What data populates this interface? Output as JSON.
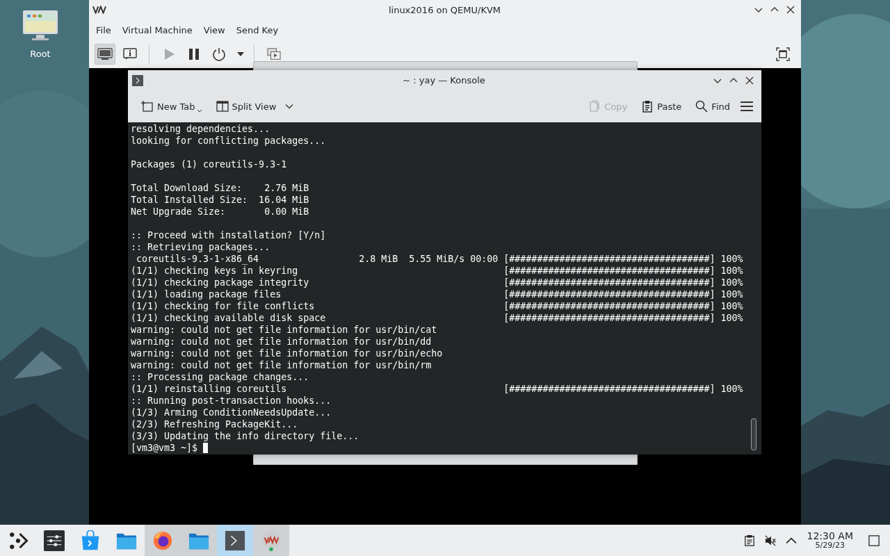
{
  "desktop": {
    "icons": [
      {
        "label": "Root"
      }
    ]
  },
  "vm_window": {
    "title": "linux2016 on QEMU/KVM",
    "menu": [
      "File",
      "Virtual Machine",
      "View",
      "Send Key"
    ],
    "view_buttons": [
      {
        "kind": "console",
        "selected": true
      },
      {
        "kind": "details",
        "selected": false
      }
    ],
    "actions": [
      {
        "kind": "run",
        "disabled": true
      },
      {
        "kind": "pause",
        "disabled": false
      },
      {
        "kind": "power",
        "disabled": false
      },
      {
        "kind": "dropdown",
        "disabled": false
      }
    ]
  },
  "konsole": {
    "title": "~ : yay — Konsole",
    "tools": [
      {
        "kind": "new-tab",
        "label": "New Tab"
      },
      {
        "kind": "split-view",
        "label": "Split View"
      }
    ],
    "actions": [
      {
        "kind": "copy",
        "label": "Copy",
        "disabled": true
      },
      {
        "kind": "paste",
        "label": "Paste",
        "disabled": false
      },
      {
        "kind": "find",
        "label": "Find",
        "disabled": false
      }
    ],
    "lines": [
      {
        "kind": "text",
        "text": "resolving dependencies..."
      },
      {
        "kind": "text",
        "text": "looking for conflicting packages..."
      },
      {
        "kind": "blank"
      },
      {
        "kind": "text",
        "text": "Packages (1) coreutils-9.3-1"
      },
      {
        "kind": "blank"
      },
      {
        "kind": "text",
        "text": "Total Download Size:    2.76 MiB"
      },
      {
        "kind": "text",
        "text": "Total Installed Size:  16.04 MiB"
      },
      {
        "kind": "text",
        "text": "Net Upgrade Size:       0.00 MiB"
      },
      {
        "kind": "blank"
      },
      {
        "kind": "text",
        "text": ":: Proceed with installation? [Y/n]"
      },
      {
        "kind": "text",
        "text": ":: Retrieving packages..."
      },
      {
        "kind": "progress",
        "label": " coreutils-9.3-1-x86_64",
        "size": "2.8 MiB",
        "rate": "5.55 MiB/s",
        "time": "00:00",
        "bar": "[####################################]",
        "percent": "100%"
      },
      {
        "kind": "progress",
        "label": "(1/1) checking keys in keyring",
        "bar": "[####################################]",
        "percent": "100%"
      },
      {
        "kind": "progress",
        "label": "(1/1) checking package integrity",
        "bar": "[####################################]",
        "percent": "100%"
      },
      {
        "kind": "progress",
        "label": "(1/1) loading package files",
        "bar": "[####################################]",
        "percent": "100%"
      },
      {
        "kind": "progress",
        "label": "(1/1) checking for file conflicts",
        "bar": "[####################################]",
        "percent": "100%"
      },
      {
        "kind": "progress",
        "label": "(1/1) checking available disk space",
        "bar": "[####################################]",
        "percent": "100%"
      },
      {
        "kind": "text",
        "text": "warning: could not get file information for usr/bin/cat"
      },
      {
        "kind": "text",
        "text": "warning: could not get file information for usr/bin/dd"
      },
      {
        "kind": "text",
        "text": "warning: could not get file information for usr/bin/echo"
      },
      {
        "kind": "text",
        "text": "warning: could not get file information for usr/bin/rm"
      },
      {
        "kind": "text",
        "text": ":: Processing package changes..."
      },
      {
        "kind": "progress",
        "label": "(1/1) reinstalling coreutils",
        "bar": "[####################################]",
        "percent": "100%"
      },
      {
        "kind": "text",
        "text": ":: Running post-transaction hooks..."
      },
      {
        "kind": "text",
        "text": "(1/3) Arming ConditionNeedsUpdate..."
      },
      {
        "kind": "text",
        "text": "(2/3) Refreshing PackageKit..."
      },
      {
        "kind": "text",
        "text": "(3/3) Updating the info directory file..."
      }
    ],
    "prompt": "[vm3@vm3 ~]$"
  },
  "taskbar": {
    "items": [
      {
        "kind": "launcher",
        "running": false,
        "selected": false
      },
      {
        "kind": "settings",
        "running": false,
        "selected": false
      },
      {
        "kind": "store",
        "running": false,
        "selected": false
      },
      {
        "kind": "folder",
        "running": false,
        "selected": false
      },
      {
        "kind": "browser",
        "running": true,
        "selected": false
      },
      {
        "kind": "folder",
        "running": true,
        "selected": false
      },
      {
        "kind": "terminal",
        "running": true,
        "selected": true
      },
      {
        "kind": "vm",
        "running": true,
        "selected": false
      }
    ],
    "tray": [
      {
        "kind": "clipboard"
      },
      {
        "kind": "speaker-muted"
      },
      {
        "kind": "expand"
      }
    ],
    "clock": {
      "time": "12:30 AM",
      "date": "5/29/23"
    }
  }
}
